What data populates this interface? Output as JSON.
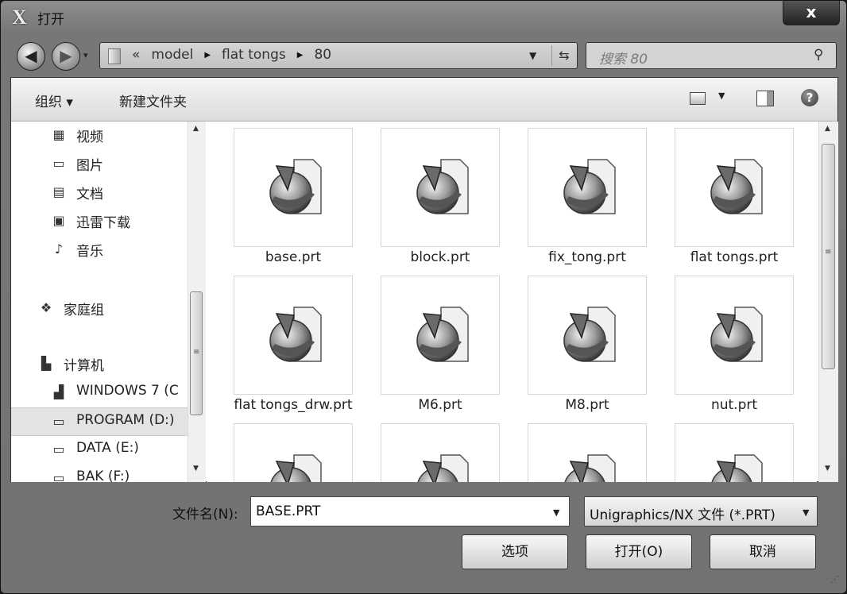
{
  "window": {
    "title": "打开",
    "logo": "X",
    "close_label": "x"
  },
  "navigation": {
    "back_icon": "◀",
    "forward_icon": "▶"
  },
  "address": {
    "overflow": "«",
    "crumbs": [
      "model",
      "flat tongs",
      "80"
    ]
  },
  "search": {
    "placeholder": "搜索 80"
  },
  "toolbar": {
    "organize": "组织 ▾",
    "new_folder": "新建文件夹"
  },
  "nav_items": [
    {
      "label": "视频",
      "icon": "video-icon",
      "glyph": "▦"
    },
    {
      "label": "图片",
      "icon": "picture-icon",
      "glyph": "▭"
    },
    {
      "label": "文档",
      "icon": "document-icon",
      "glyph": "▤"
    },
    {
      "label": "迅雷下载",
      "icon": "download-icon",
      "glyph": "▣"
    },
    {
      "label": "音乐",
      "icon": "music-icon",
      "glyph": "♪"
    },
    {
      "label": "家庭组",
      "icon": "homegroup-icon",
      "glyph": "❖"
    },
    {
      "label": "计算机",
      "icon": "computer-icon",
      "glyph": "▙"
    },
    {
      "label": "WINDOWS 7 (C",
      "icon": "drive-icon",
      "glyph": "▟"
    },
    {
      "label": "PROGRAM (D:)",
      "icon": "drive-icon",
      "glyph": "▭"
    },
    {
      "label": "DATA (E:)",
      "icon": "drive-icon",
      "glyph": "▭"
    },
    {
      "label": "BAK (F:)",
      "icon": "drive-icon",
      "glyph": "▭"
    }
  ],
  "files": [
    {
      "name": "base.prt"
    },
    {
      "name": "block.prt"
    },
    {
      "name": "fix_tong.prt"
    },
    {
      "name": "flat tongs.prt"
    },
    {
      "name": "flat tongs_drw.prt"
    },
    {
      "name": "M6.prt"
    },
    {
      "name": "M8.prt"
    },
    {
      "name": "nut.prt"
    },
    {
      "name": ""
    },
    {
      "name": ""
    },
    {
      "name": ""
    },
    {
      "name": ""
    }
  ],
  "filename": {
    "label": "文件名(N):",
    "value": "BASE.PRT"
  },
  "filetype": {
    "value": "Unigraphics/NX 文件 (*.PRT)"
  },
  "buttons": {
    "options": "选项",
    "open": "打开(O)",
    "cancel": "取消"
  }
}
